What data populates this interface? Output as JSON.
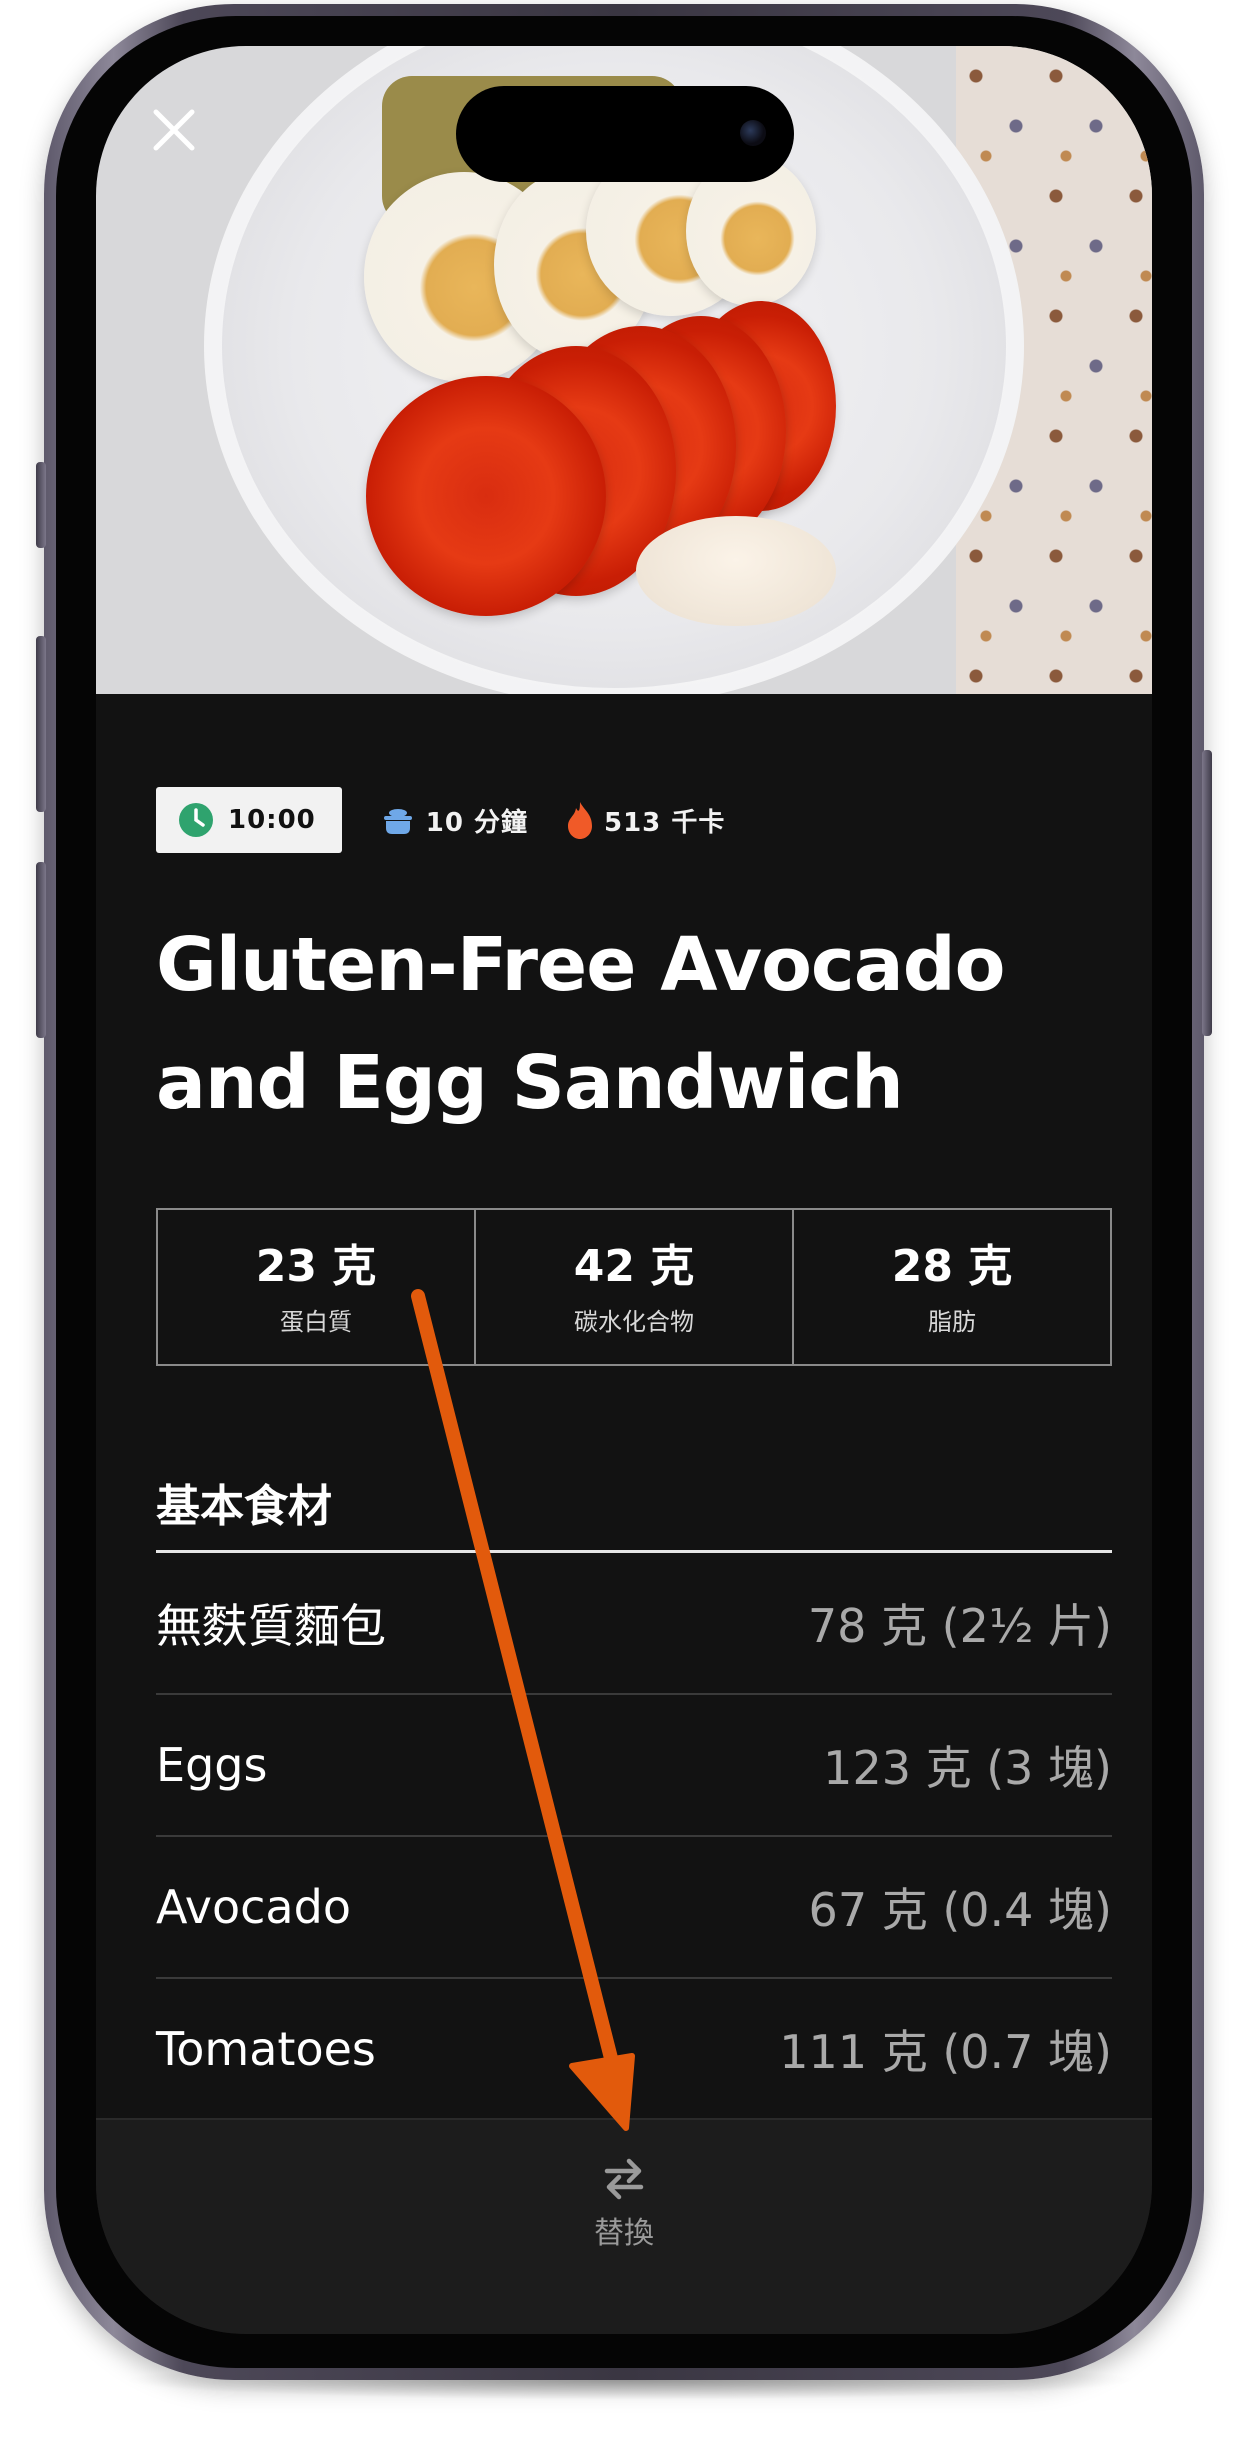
{
  "recipe": {
    "time_chip": "10:00",
    "cook_time": "10 分鐘",
    "calories": "513 千卡",
    "title_line1": "Gluten-Free Avocado",
    "title_line2": "and Egg Sandwich"
  },
  "macros": [
    {
      "value": "23 克",
      "label": "蛋白質"
    },
    {
      "value": "42 克",
      "label": "碳水化合物"
    },
    {
      "value": "28 克",
      "label": "脂肪"
    }
  ],
  "ingredients": {
    "section_title": "基本食材",
    "items": [
      {
        "name": "無麩質麵包",
        "qty": "78 克 (2½ 片)"
      },
      {
        "name": "Eggs",
        "qty": "123 克 (3 塊)"
      },
      {
        "name": "Avocado",
        "qty": "67 克 (0.4 塊)"
      },
      {
        "name": "Tomatoes",
        "qty": "111 克 (0.7 塊)"
      }
    ]
  },
  "bottom_bar": {
    "replace_label": "替換"
  },
  "colors": {
    "background": "#121212",
    "clock_green": "#2fa36e",
    "pot_blue": "#6fa8e8",
    "flame_orange": "#f05a28",
    "arrow_orange": "#e25a0c"
  },
  "icons": [
    "close-icon",
    "clock-icon",
    "pot-icon",
    "flame-icon",
    "swap-arrows-icon"
  ]
}
